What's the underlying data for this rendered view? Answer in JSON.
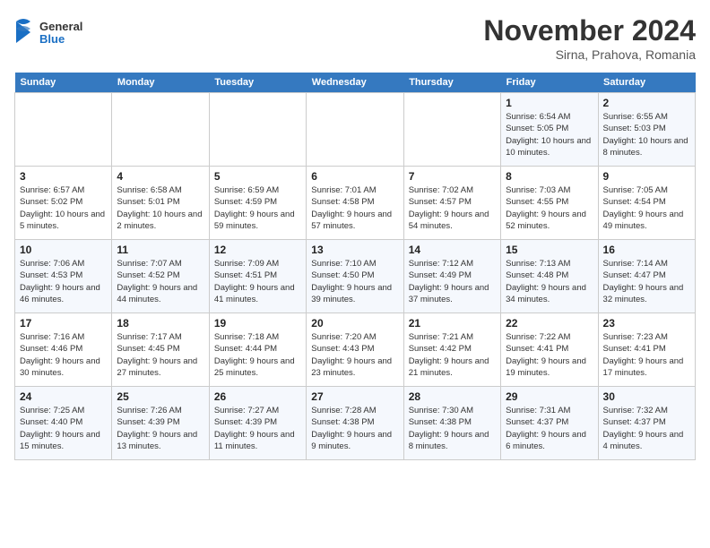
{
  "logo": {
    "line1": "General",
    "line2": "Blue"
  },
  "title": "November 2024",
  "subtitle": "Sirna, Prahova, Romania",
  "weekdays": [
    "Sunday",
    "Monday",
    "Tuesday",
    "Wednesday",
    "Thursday",
    "Friday",
    "Saturday"
  ],
  "weeks": [
    [
      {
        "day": "",
        "detail": ""
      },
      {
        "day": "",
        "detail": ""
      },
      {
        "day": "",
        "detail": ""
      },
      {
        "day": "",
        "detail": ""
      },
      {
        "day": "",
        "detail": ""
      },
      {
        "day": "1",
        "detail": "Sunrise: 6:54 AM\nSunset: 5:05 PM\nDaylight: 10 hours\nand 10 minutes."
      },
      {
        "day": "2",
        "detail": "Sunrise: 6:55 AM\nSunset: 5:03 PM\nDaylight: 10 hours\nand 8 minutes."
      }
    ],
    [
      {
        "day": "3",
        "detail": "Sunrise: 6:57 AM\nSunset: 5:02 PM\nDaylight: 10 hours\nand 5 minutes."
      },
      {
        "day": "4",
        "detail": "Sunrise: 6:58 AM\nSunset: 5:01 PM\nDaylight: 10 hours\nand 2 minutes."
      },
      {
        "day": "5",
        "detail": "Sunrise: 6:59 AM\nSunset: 4:59 PM\nDaylight: 9 hours\nand 59 minutes."
      },
      {
        "day": "6",
        "detail": "Sunrise: 7:01 AM\nSunset: 4:58 PM\nDaylight: 9 hours\nand 57 minutes."
      },
      {
        "day": "7",
        "detail": "Sunrise: 7:02 AM\nSunset: 4:57 PM\nDaylight: 9 hours\nand 54 minutes."
      },
      {
        "day": "8",
        "detail": "Sunrise: 7:03 AM\nSunset: 4:55 PM\nDaylight: 9 hours\nand 52 minutes."
      },
      {
        "day": "9",
        "detail": "Sunrise: 7:05 AM\nSunset: 4:54 PM\nDaylight: 9 hours\nand 49 minutes."
      }
    ],
    [
      {
        "day": "10",
        "detail": "Sunrise: 7:06 AM\nSunset: 4:53 PM\nDaylight: 9 hours\nand 46 minutes."
      },
      {
        "day": "11",
        "detail": "Sunrise: 7:07 AM\nSunset: 4:52 PM\nDaylight: 9 hours\nand 44 minutes."
      },
      {
        "day": "12",
        "detail": "Sunrise: 7:09 AM\nSunset: 4:51 PM\nDaylight: 9 hours\nand 41 minutes."
      },
      {
        "day": "13",
        "detail": "Sunrise: 7:10 AM\nSunset: 4:50 PM\nDaylight: 9 hours\nand 39 minutes."
      },
      {
        "day": "14",
        "detail": "Sunrise: 7:12 AM\nSunset: 4:49 PM\nDaylight: 9 hours\nand 37 minutes."
      },
      {
        "day": "15",
        "detail": "Sunrise: 7:13 AM\nSunset: 4:48 PM\nDaylight: 9 hours\nand 34 minutes."
      },
      {
        "day": "16",
        "detail": "Sunrise: 7:14 AM\nSunset: 4:47 PM\nDaylight: 9 hours\nand 32 minutes."
      }
    ],
    [
      {
        "day": "17",
        "detail": "Sunrise: 7:16 AM\nSunset: 4:46 PM\nDaylight: 9 hours\nand 30 minutes."
      },
      {
        "day": "18",
        "detail": "Sunrise: 7:17 AM\nSunset: 4:45 PM\nDaylight: 9 hours\nand 27 minutes."
      },
      {
        "day": "19",
        "detail": "Sunrise: 7:18 AM\nSunset: 4:44 PM\nDaylight: 9 hours\nand 25 minutes."
      },
      {
        "day": "20",
        "detail": "Sunrise: 7:20 AM\nSunset: 4:43 PM\nDaylight: 9 hours\nand 23 minutes."
      },
      {
        "day": "21",
        "detail": "Sunrise: 7:21 AM\nSunset: 4:42 PM\nDaylight: 9 hours\nand 21 minutes."
      },
      {
        "day": "22",
        "detail": "Sunrise: 7:22 AM\nSunset: 4:41 PM\nDaylight: 9 hours\nand 19 minutes."
      },
      {
        "day": "23",
        "detail": "Sunrise: 7:23 AM\nSunset: 4:41 PM\nDaylight: 9 hours\nand 17 minutes."
      }
    ],
    [
      {
        "day": "24",
        "detail": "Sunrise: 7:25 AM\nSunset: 4:40 PM\nDaylight: 9 hours\nand 15 minutes."
      },
      {
        "day": "25",
        "detail": "Sunrise: 7:26 AM\nSunset: 4:39 PM\nDaylight: 9 hours\nand 13 minutes."
      },
      {
        "day": "26",
        "detail": "Sunrise: 7:27 AM\nSunset: 4:39 PM\nDaylight: 9 hours\nand 11 minutes."
      },
      {
        "day": "27",
        "detail": "Sunrise: 7:28 AM\nSunset: 4:38 PM\nDaylight: 9 hours\nand 9 minutes."
      },
      {
        "day": "28",
        "detail": "Sunrise: 7:30 AM\nSunset: 4:38 PM\nDaylight: 9 hours\nand 8 minutes."
      },
      {
        "day": "29",
        "detail": "Sunrise: 7:31 AM\nSunset: 4:37 PM\nDaylight: 9 hours\nand 6 minutes."
      },
      {
        "day": "30",
        "detail": "Sunrise: 7:32 AM\nSunset: 4:37 PM\nDaylight: 9 hours\nand 4 minutes."
      }
    ]
  ]
}
